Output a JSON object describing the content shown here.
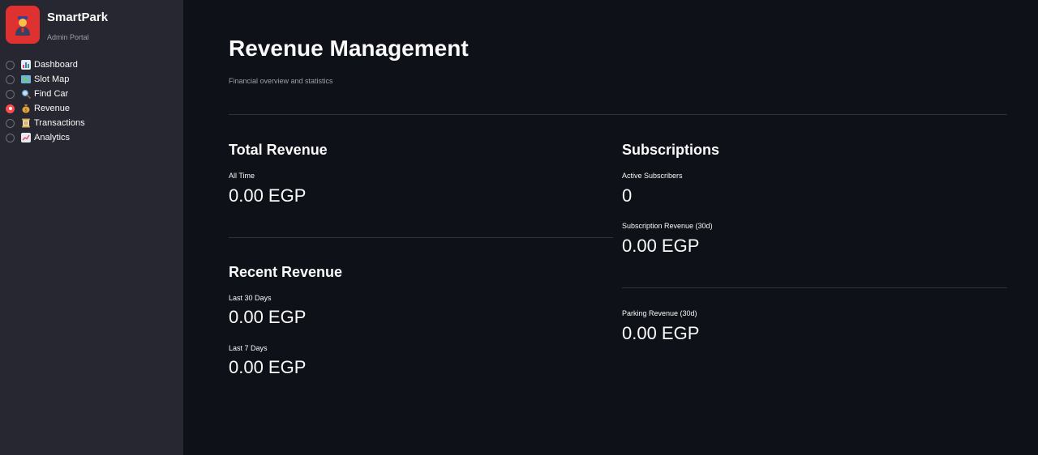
{
  "sidebar": {
    "brand": {
      "name": "SmartPark",
      "subtitle": "Admin Portal"
    },
    "nav": [
      {
        "label": "Dashboard",
        "icon": "bar-chart-icon",
        "selected": false
      },
      {
        "label": "Slot Map",
        "icon": "map-icon",
        "selected": false
      },
      {
        "label": "Find Car",
        "icon": "magnifier-icon",
        "selected": false
      },
      {
        "label": "Revenue",
        "icon": "money-bag-icon",
        "selected": true
      },
      {
        "label": "Transactions",
        "icon": "scroll-icon",
        "selected": false
      },
      {
        "label": "Analytics",
        "icon": "trending-chart-icon",
        "selected": false
      }
    ]
  },
  "main": {
    "title": "Revenue Management",
    "subtitle": "Financial overview and statistics",
    "total_revenue": {
      "heading": "Total Revenue",
      "label": "All Time",
      "value": "0.00 EGP"
    },
    "recent_revenue": {
      "heading": "Recent Revenue",
      "last30_label": "Last 30 Days",
      "last30_value": "0.00 EGP",
      "last7_label": "Last 7 Days",
      "last7_value": "0.00 EGP"
    },
    "subscriptions": {
      "heading": "Subscriptions",
      "active_label": "Active Subscribers",
      "active_value": "0",
      "sub_rev_label": "Subscription Revenue (30d)",
      "sub_rev_value": "0.00 EGP",
      "parking_rev_label": "Parking Revenue (30d)",
      "parking_rev_value": "0.00 EGP"
    }
  },
  "colors": {
    "background": "#0e1117",
    "sidebar": "#262730",
    "accent": "#ff4b4b",
    "logo": "#e03131"
  }
}
